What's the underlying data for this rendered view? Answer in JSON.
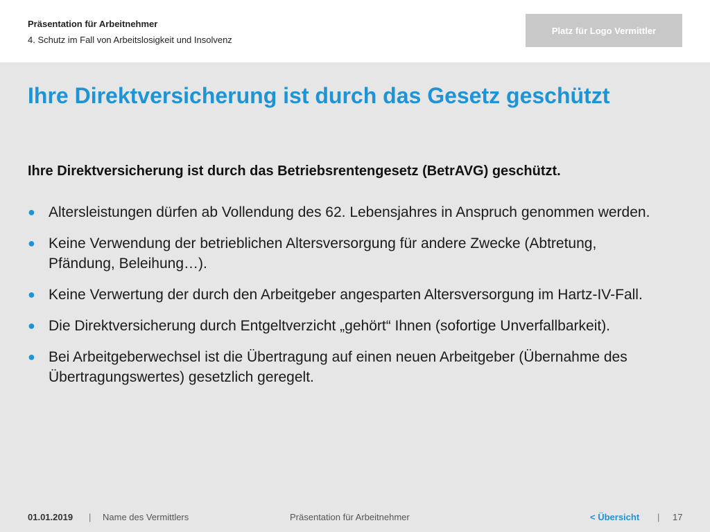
{
  "header": {
    "deck_title": "Präsentation für Arbeitnehmer",
    "section": "4. Schutz im Fall von Arbeitslosigkeit und Insolvenz",
    "logo_placeholder": "Platz für Logo Vermittler"
  },
  "slide": {
    "title": "Ihre Direktversicherung ist durch das Gesetz geschützt",
    "lead": "Ihre Direktversicherung ist durch das Betriebsrentengesetz (BetrAVG) geschützt.",
    "bullet_glyph": "●",
    "bullets": [
      "Altersleistungen dürfen ab Vollendung des 62. Lebensjahres in Anspruch genommen werden.",
      "Keine Verwendung der betrieblichen Altersversorgung für andere Zwecke (Abtretung, Pfändung, Beleihung…).",
      "Keine Verwertung der durch den Arbeitgeber angesparten Altersversorgung im Hartz-IV-Fall.",
      "Die Direktversicherung durch Entgeltverzicht „gehört“ Ihnen (sofortige Unverfallbarkeit).",
      "Bei Arbeitgeberwechsel ist die Übertragung auf einen neuen Arbeitgeber (Übernahme des Übertragungswertes) gesetzlich geregelt."
    ]
  },
  "footer": {
    "date": "01.01.2019",
    "separator": "|",
    "agent_name": "Name des Vermittlers",
    "center_title": "Präsentation für Arbeitnehmer",
    "overview_link": "< Übersicht",
    "page_number": "17"
  },
  "colors": {
    "accent": "#1f93d3",
    "content_background": "#e6e6e6",
    "header_background": "#ffffff",
    "logo_box": "#c8c8c8"
  }
}
